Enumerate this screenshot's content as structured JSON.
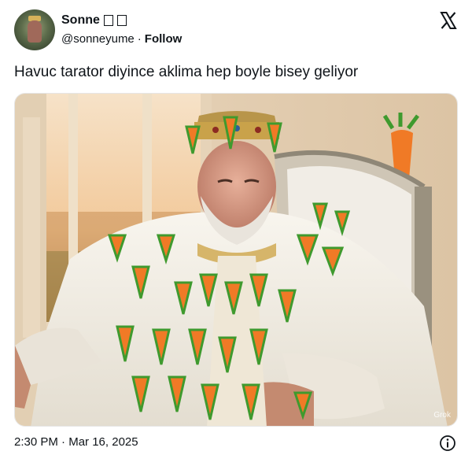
{
  "author": {
    "display_name": "Sonne",
    "handle": "@sonneyume",
    "separator": "·",
    "follow_label": "Follow"
  },
  "tweet": {
    "text": "Havuc tarator diyince aklima hep boyle bisey geliyor"
  },
  "media": {
    "watermark": "Grok",
    "description_icon": "carrot-king-image"
  },
  "footer": {
    "time": "2:30 PM",
    "separator": "·",
    "date": "Mar 16, 2025"
  },
  "colors": {
    "text": "#0f1419",
    "carrot": "#f07a26",
    "leaf": "#3f9a2e",
    "robe": "#f3efe6",
    "gold": "#c9a24a"
  },
  "icons": {
    "platform": "x-logo-icon",
    "info": "info-icon"
  }
}
